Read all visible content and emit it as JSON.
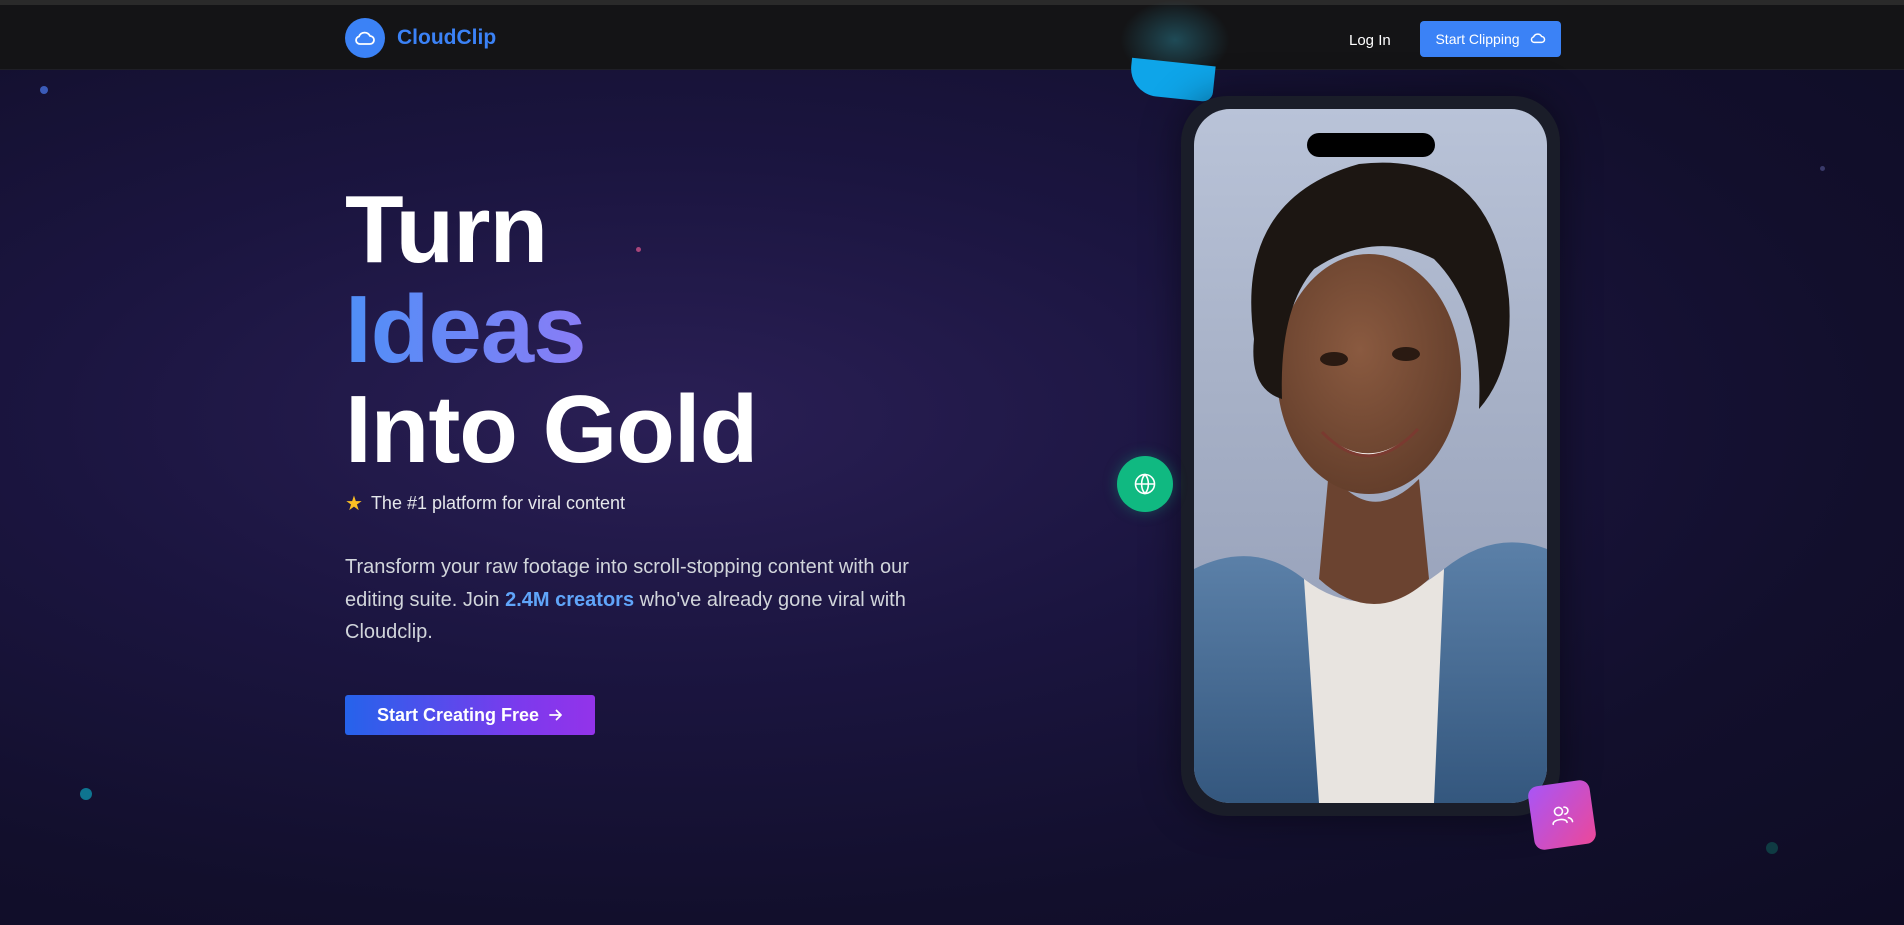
{
  "nav": {
    "brand": "CloudClip",
    "login_label": "Log In",
    "cta_label": "Start Clipping"
  },
  "hero": {
    "title_line1": "Turn",
    "title_line2": "Ideas",
    "title_line3": "Into Gold",
    "tagline": "The #1 platform for viral content",
    "desc_before": "Transform your raw footage into scroll-stopping content with our editing suite. Join ",
    "desc_highlight": "2.4M creators",
    "desc_after": " who've already gone viral with Cloudclip.",
    "cta_label": "Start Creating Free"
  },
  "icons": {
    "logo": "cloud-icon",
    "nav_cta": "cloud-icon",
    "tagline": "star-icon",
    "cta": "arrow-right-icon",
    "floating_left": "globe-icon",
    "floating_bottom": "users-icon"
  },
  "colors": {
    "accent": "#3b82f6",
    "gradient_start": "#2563eb",
    "gradient_end": "#9333ea",
    "highlight": "#60a5fa",
    "globe_badge": "#10b981",
    "users_badge_start": "#a855f7",
    "users_badge_end": "#ec4899"
  }
}
